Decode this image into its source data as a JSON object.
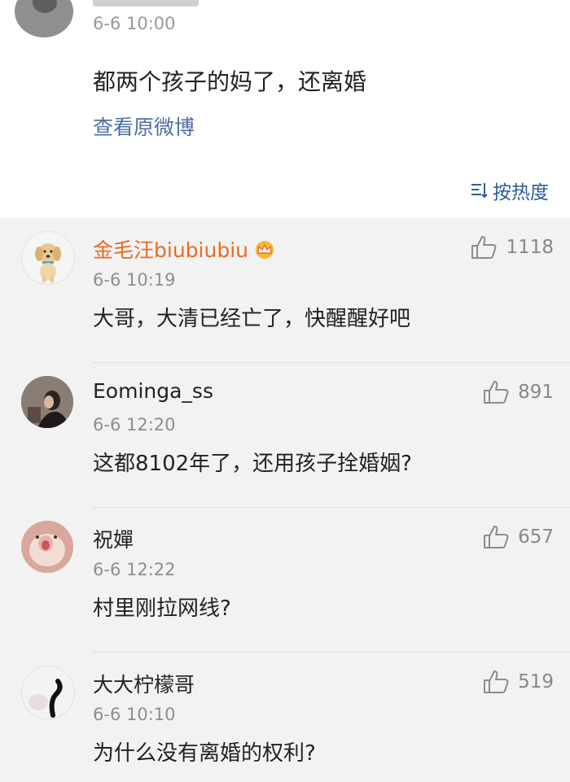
{
  "post": {
    "time": "6-6 10:00",
    "text": "都两个孩子的妈了，还离婚",
    "view_original": "查看原微博",
    "sort_label": "按热度"
  },
  "comments": [
    {
      "name": "金毛汪biubiubiu",
      "vip": true,
      "time": "6-6 10:19",
      "text": "大哥，大清已经亡了，快醒醒好吧",
      "likes": "1118",
      "avatar_icon": "golden-retriever-avatar"
    },
    {
      "name": "Eominga_ss",
      "vip": false,
      "time": "6-6 12:20",
      "text": "这都8102年了，还用孩子拴婚姻?",
      "likes": "891",
      "avatar_icon": "woman-photo-avatar"
    },
    {
      "name": "祝嬋",
      "vip": false,
      "time": "6-6 12:22",
      "text": "村里刚拉网线?",
      "likes": "657",
      "avatar_icon": "hamster-avatar"
    },
    {
      "name": "大大柠檬哥",
      "vip": false,
      "time": "6-6 10:10",
      "text": "为什么没有离婚的权利?",
      "likes": "519",
      "avatar_icon": "cat-tail-avatar"
    }
  ],
  "colors": {
    "link": "#4b6fa1",
    "vip_name": "#e86c26",
    "meta": "#8e8e8e",
    "comment_bg": "#f2f2f2"
  }
}
